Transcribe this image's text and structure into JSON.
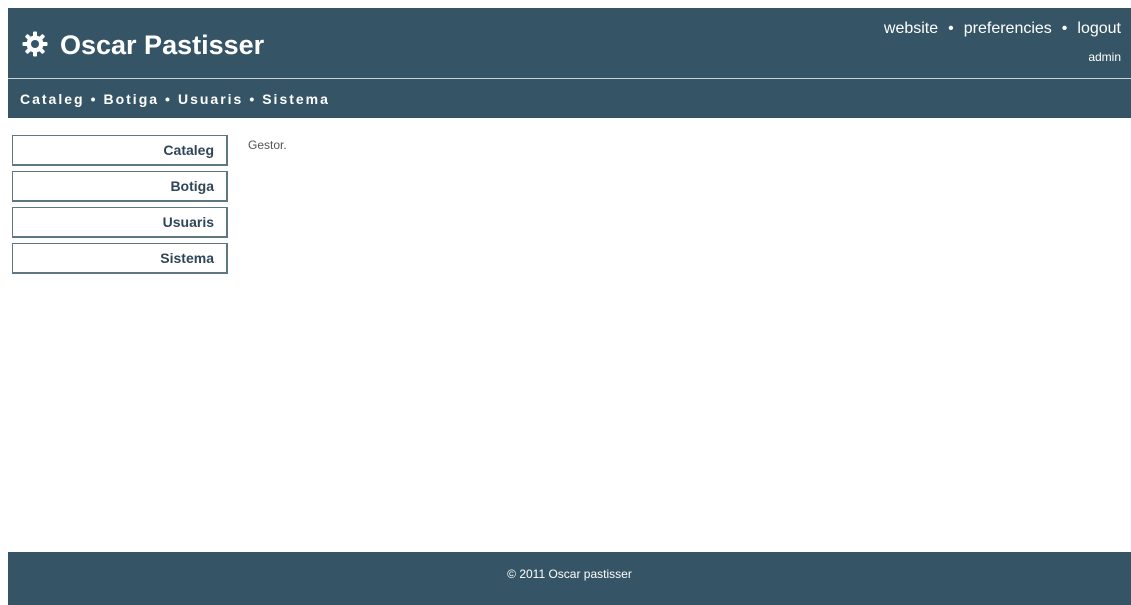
{
  "header": {
    "title": "Oscar Pastisser",
    "logo_icon": "gear-icon",
    "top_links": [
      {
        "label": "website"
      },
      {
        "label": "preferencies"
      },
      {
        "label": "logout"
      }
    ],
    "separator": "•",
    "username": "admin"
  },
  "main_nav": {
    "items": [
      {
        "label": "Cataleg"
      },
      {
        "label": "Botiga"
      },
      {
        "label": "Usuaris"
      },
      {
        "label": "Sistema"
      }
    ],
    "separator": "•"
  },
  "sidebar": {
    "items": [
      {
        "label": "Cataleg"
      },
      {
        "label": "Botiga"
      },
      {
        "label": "Usuaris"
      },
      {
        "label": "Sistema"
      }
    ]
  },
  "content": {
    "text": "Gestor."
  },
  "footer": {
    "text": "© 2011 Oscar pastisser"
  },
  "colors": {
    "header_bg": "#355566",
    "sidebar_text": "#2f4658",
    "sidebar_border": "#5f7683"
  }
}
